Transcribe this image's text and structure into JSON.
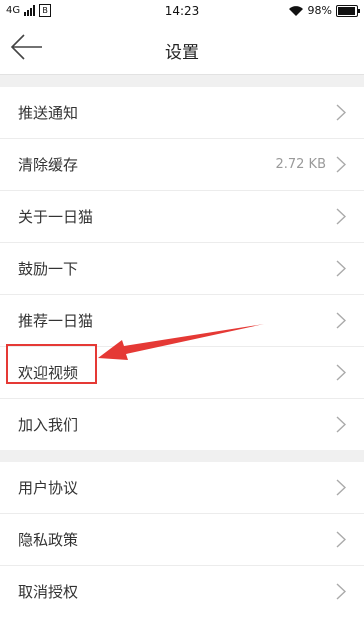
{
  "status_bar": {
    "network": "4G",
    "carrier_icon_text": "B",
    "time": "14:23",
    "battery_percent": "98%",
    "battery_level": 0.98
  },
  "nav": {
    "back_icon": "back-arrow-icon",
    "title": "设置"
  },
  "groups": [
    {
      "items": [
        {
          "label": "推送通知",
          "value": ""
        },
        {
          "label": "清除缓存",
          "value": "2.72 KB"
        },
        {
          "label": "关于一日猫",
          "value": ""
        },
        {
          "label": "鼓励一下",
          "value": ""
        },
        {
          "label": "推荐一日猫",
          "value": ""
        },
        {
          "label": "欢迎视频",
          "value": ""
        },
        {
          "label": "加入我们",
          "value": ""
        }
      ]
    },
    {
      "items": [
        {
          "label": "用户协议",
          "value": ""
        },
        {
          "label": "隐私政策",
          "value": ""
        },
        {
          "label": "取消授权",
          "value": ""
        }
      ]
    }
  ],
  "annotation": {
    "color": "#e53935",
    "highlighted_item": "欢迎视频"
  }
}
